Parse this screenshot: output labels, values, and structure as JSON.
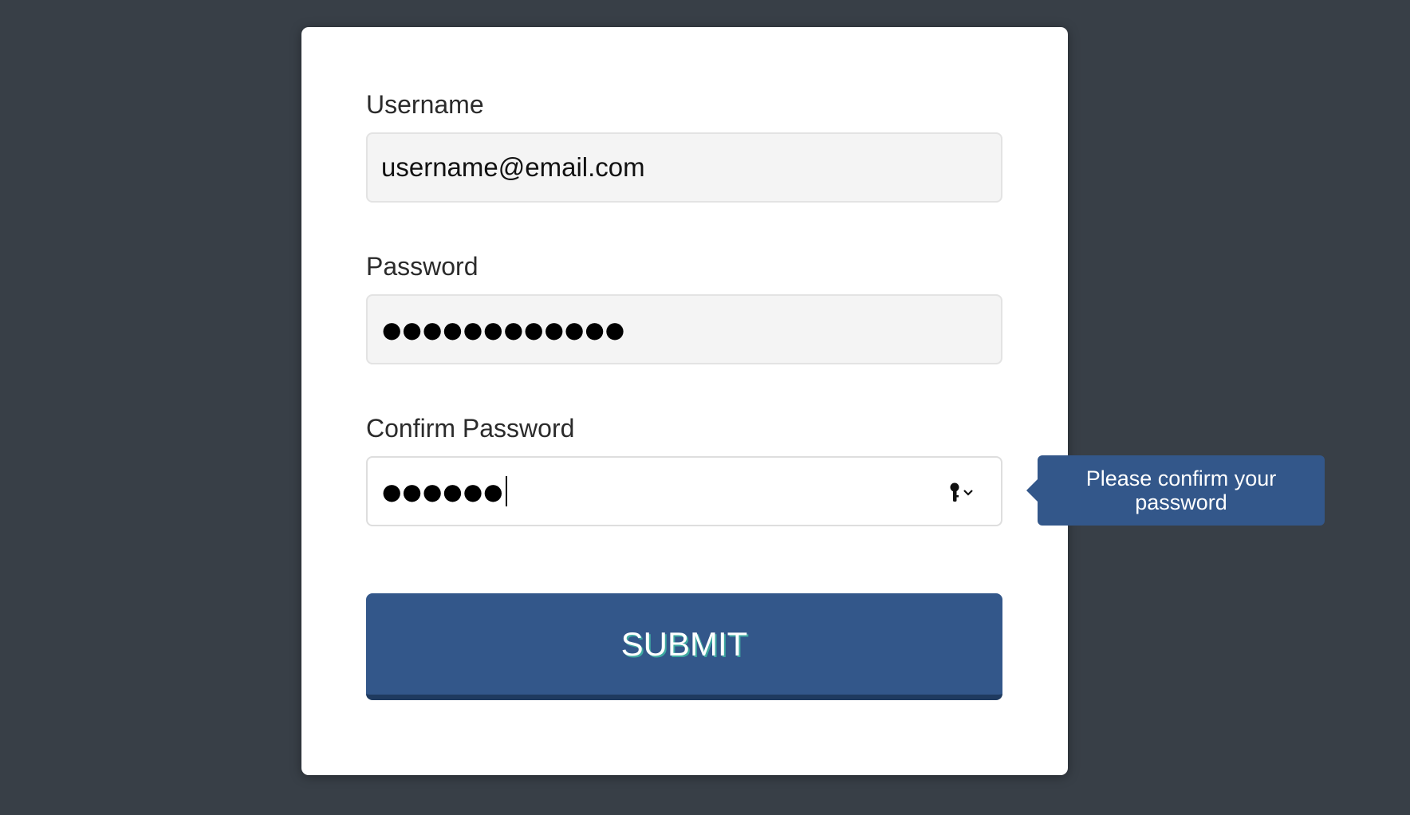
{
  "form": {
    "username_label": "Username",
    "username_value": "username@email.com",
    "password_label": "Password",
    "password_masked": "●●●●●●●●●●●●",
    "confirm_label": "Confirm Password",
    "confirm_masked": "●●●●●●",
    "submit_label": "SUBMIT"
  },
  "tooltip": {
    "text": "Please confirm your password"
  },
  "icons": {
    "password_autofill": "key-icon",
    "dropdown": "chevron-down-icon"
  },
  "colors": {
    "background": "#383f47",
    "card": "#ffffff",
    "accent": "#33578a",
    "accent_dark": "#1f3a5f",
    "submit_text_shadow": "#3fa9a1",
    "input_fill": "#f4f4f4"
  }
}
